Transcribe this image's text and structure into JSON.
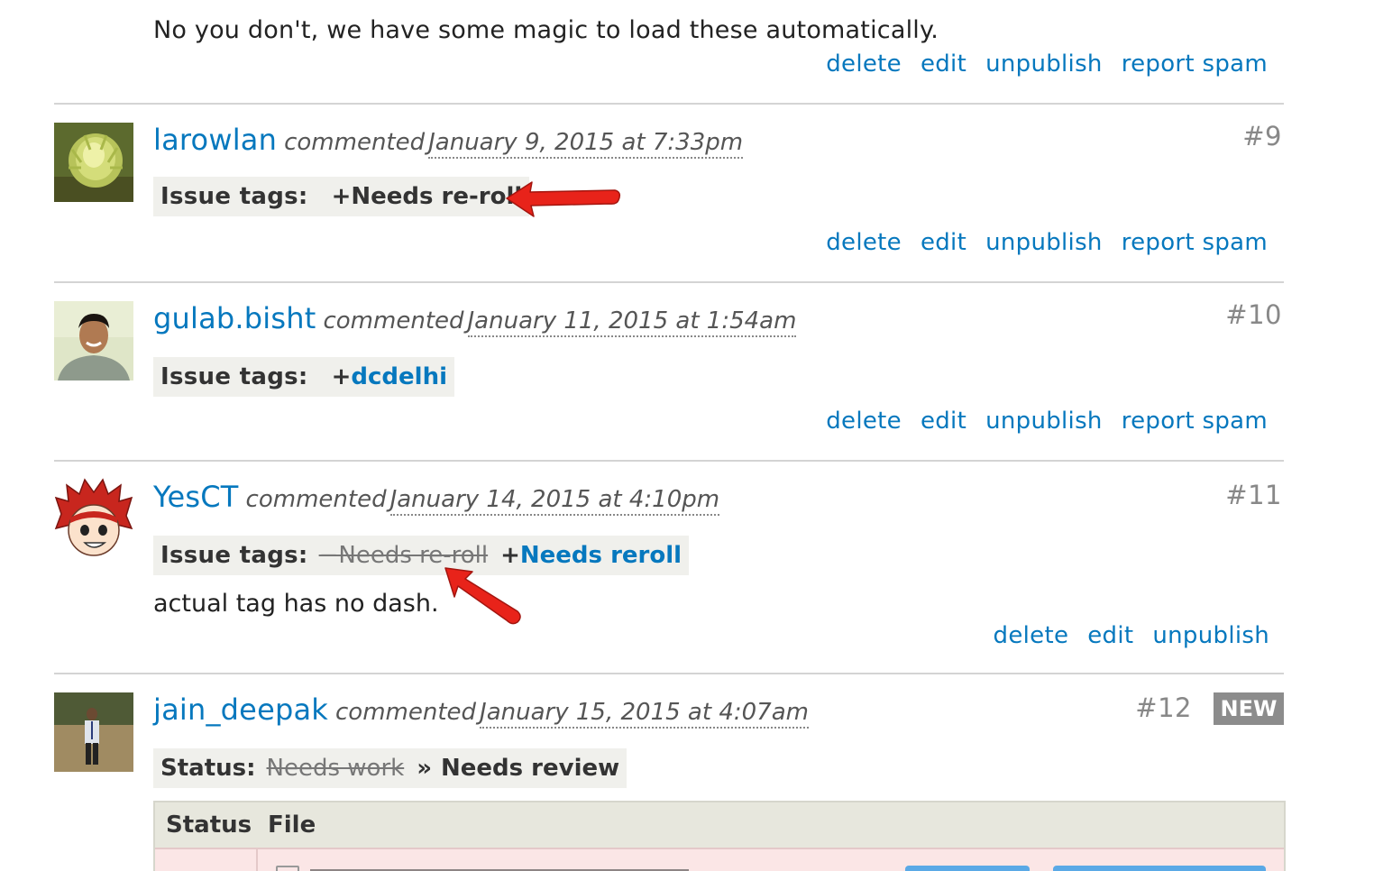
{
  "intro": {
    "text": "No you don't, we have some magic to load these automatically."
  },
  "actions": {
    "delete": "delete",
    "edit": "edit",
    "unpublish": "unpublish",
    "report_spam": "report spam"
  },
  "comments": [
    {
      "user": "larowlan",
      "verb": "commented",
      "date": "January 9, 2015 at 7:33pm",
      "number": "#9",
      "tags_label": "Issue tags:",
      "tag_added": "+Needs re-roll"
    },
    {
      "user": "gulab.bisht",
      "verb": "commented",
      "date": "January 11, 2015 at 1:54am",
      "number": "#10",
      "tags_label": "Issue tags:",
      "tag_plus": "+",
      "tag_added": "dcdelhi"
    },
    {
      "user": "YesCT",
      "verb": "commented",
      "date": "January 14, 2015 at 4:10pm",
      "number": "#11",
      "tags_label": "Issue tags:",
      "tag_removed": "−Needs re-roll",
      "tag_plus": "+",
      "tag_added": "Needs reroll",
      "body": "actual tag has no dash."
    },
    {
      "user": "jain_deepak",
      "verb": "commented",
      "date": "January 15, 2015 at 4:07am",
      "number": "#12",
      "badge": "NEW",
      "status_label": "Status:",
      "status_old": "Needs work",
      "status_sep": "»",
      "status_new": "Needs review",
      "table": {
        "col_status": "Status",
        "col_file": "File"
      }
    }
  ],
  "colors": {
    "link": "#0678be",
    "tag_bg": "#f0f0ec",
    "arrow": "#e8231a",
    "new_badge": "#8c8c8c"
  }
}
